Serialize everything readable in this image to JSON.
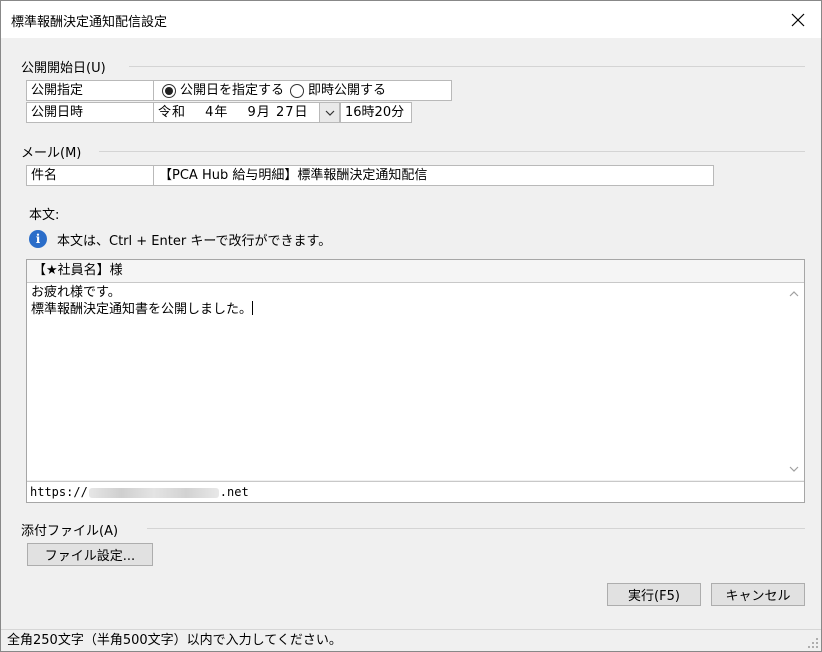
{
  "window": {
    "title": "標準報酬決定通知配信設定"
  },
  "publish": {
    "section_label": "公開開始日(U)",
    "spec_label": "公開指定",
    "options": [
      {
        "label": "公開日を指定する",
        "selected": true
      },
      {
        "label": "即時公開する",
        "selected": false
      }
    ],
    "datetime_label": "公開日時",
    "date_value": "令和　 4年　 9月 27日",
    "time_value": "16時20分"
  },
  "mail": {
    "section_label": "メール(M)",
    "subject_label": "件名",
    "subject_value": "【PCA Hub 給与明細】標準報酬決定通知配信"
  },
  "body": {
    "label": "本文:",
    "info_text": "本文は、Ctrl + Enter キーで改行ができます。",
    "header": "【★社員名】様",
    "text_line1": "お疲れ様です。",
    "text_line2": "標準報酬決定通知書を公開しました。",
    "footer_prefix": "https://",
    "footer_suffix": ".net"
  },
  "attachment": {
    "section_label": "添付ファイル(A)",
    "button_label": "ファイル設定..."
  },
  "actions": {
    "execute_label": "実行(F5)",
    "cancel_label": "キャンセル"
  },
  "status": {
    "text": "全角250文字（半角500文字）以内で入力してください。"
  },
  "colors": {
    "info_icon": "#2a6dc9",
    "window_bg": "#f0f0f0"
  }
}
